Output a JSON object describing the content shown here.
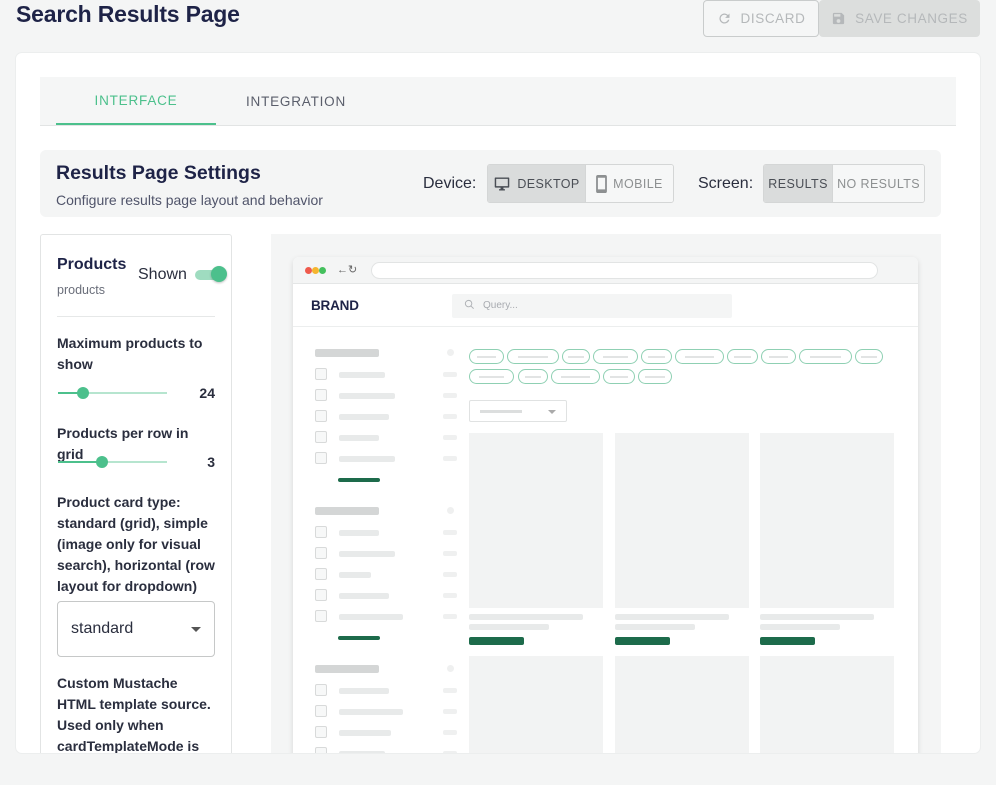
{
  "page": {
    "title": "Search Results Page"
  },
  "toolbar": {
    "discard_label": "DISCARD",
    "save_label": "SAVE CHANGES"
  },
  "tabs": [
    {
      "label": "INTERFACE",
      "active": true
    },
    {
      "label": "INTEGRATION",
      "active": false
    }
  ],
  "settings": {
    "title": "Results Page Settings",
    "subtitle": "Configure results page layout and behavior",
    "device_label": "Device:",
    "device_options": [
      {
        "label": "DESKTOP",
        "icon": "desktop-icon",
        "active": true
      },
      {
        "label": "MOBILE",
        "icon": "mobile-icon",
        "active": false
      }
    ],
    "screen_label": "Screen:",
    "screen_options": [
      {
        "label": "RESULTS",
        "active": true
      },
      {
        "label": "NO RESULTS",
        "active": false
      }
    ]
  },
  "products_panel": {
    "title": "Products",
    "subtitle": "products",
    "shown_label": "Shown",
    "shown": true,
    "max_products_label": "Maximum products to show",
    "max_products_value": "24",
    "max_products_fraction": 0.23,
    "per_row_label": "Products per row in grid",
    "per_row_value": "3",
    "per_row_fraction": 0.4,
    "card_type_label": "Product card type: standard (grid), simple (image only for visual search), horizontal (row layout for dropdown)",
    "card_type_value": "standard",
    "template_label": "Custom Mustache HTML template source. Used only when cardTemplateMode is"
  },
  "preview": {
    "brand": "BRAND",
    "search_placeholder": "Query..."
  },
  "colors": {
    "accent": "#4cc08c",
    "title": "#1e2347",
    "dark_green": "#1d6b4b"
  }
}
